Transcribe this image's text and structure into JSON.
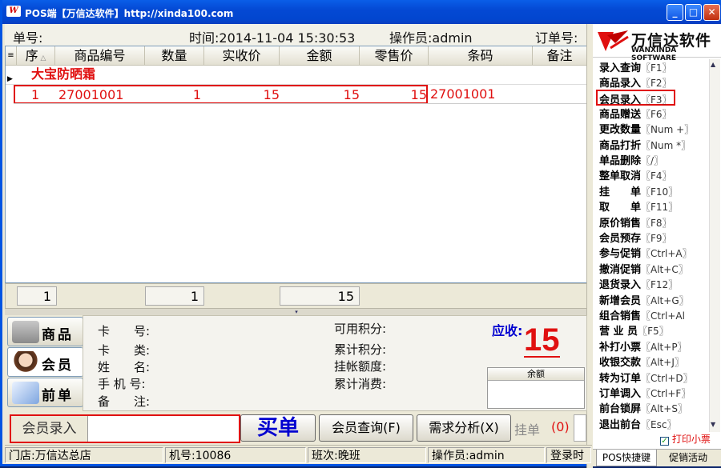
{
  "window": {
    "title": "POS端【万信达软件】http://xinda100.com",
    "app_icon": "logo-icon"
  },
  "topbar": {
    "order_no_label": "单号:",
    "time_label": "时间:2014-11-04 15:30:53",
    "operator_label": "操作员:admin",
    "pending_order_label": "订单号:"
  },
  "grid": {
    "columns": [
      "序",
      "商品编号",
      "数量",
      "实收价",
      "金额",
      "零售价",
      "条码",
      "备注"
    ],
    "group_title": "大宝防晒霜",
    "rows": [
      {
        "seq": "1",
        "code": "27001001",
        "qty": "1",
        "price": "15",
        "amount": "15",
        "retail": "15",
        "barcode": "27001001",
        "note": ""
      }
    ]
  },
  "totals": {
    "count": "1",
    "qty": "1",
    "amount": "15"
  },
  "tabs": [
    {
      "label": "商品",
      "icon": "product-icon"
    },
    {
      "label": "会员",
      "icon": "member-avatar-icon"
    },
    {
      "label": "前单",
      "icon": "previous-order-icon"
    }
  ],
  "member": {
    "card_no": "卡　　号:",
    "card_type": "卡　　类:",
    "name": "姓　　名:",
    "phone": "手 机 号:",
    "remark": "备　　注:",
    "points_available": "可用积分:",
    "points_total": "累计积分:",
    "credit_limit": "挂帐额度:",
    "total_spent": "累计消费:",
    "balance_header": "余额"
  },
  "due": {
    "label": "应收:",
    "amount": "15"
  },
  "bottom": {
    "mode_label": "会员录入",
    "input_value": "",
    "checkout": "买单",
    "member_query": "会员查询(F)",
    "demand_analysis": "需求分析(X)",
    "hold": "挂单",
    "hold_count": "(0)"
  },
  "status": {
    "store": "门店:万信达总店",
    "machine": "机号:10086",
    "shift": "班次:晚班",
    "operator": "操作员:admin",
    "login": "登录时"
  },
  "sidebar": {
    "brand_cn": "万信达软件",
    "brand_en": "WANXINDA SOFTWARE",
    "shortcuts": [
      {
        "label": "录入查询",
        "key": "〖F1〗"
      },
      {
        "label": "商品录入",
        "key": "〖F2〗"
      },
      {
        "label": "会员录入",
        "key": "〖F3〗"
      },
      {
        "label": "商品赠送",
        "key": "〖F6〗"
      },
      {
        "label": "更改数量",
        "key": "〖Num +〗"
      },
      {
        "label": "商品打折",
        "key": "〖Num *〗"
      },
      {
        "label": "单品删除",
        "key": "〖/〗"
      },
      {
        "label": "整单取消",
        "key": "〖F4〗"
      },
      {
        "label": "挂　　单",
        "key": "〖F10〗"
      },
      {
        "label": "取　　单",
        "key": "〖F11〗"
      },
      {
        "label": "原价销售",
        "key": "〖F8〗"
      },
      {
        "label": "会员预存",
        "key": "〖F9〗"
      },
      {
        "label": "参与促销",
        "key": "〖Ctrl+A〗"
      },
      {
        "label": "撤消促销",
        "key": "〖Alt+C〗"
      },
      {
        "label": "退货录入",
        "key": "〖F12〗"
      },
      {
        "label": "新增会员",
        "key": "〖Alt+G〗"
      },
      {
        "label": "组合销售",
        "key": "〖Ctrl+Al"
      },
      {
        "label": "营 业 员",
        "key": "〖F5〗"
      },
      {
        "label": "补打小票",
        "key": "〖Alt+P〗"
      },
      {
        "label": "收银交款",
        "key": "〖Alt+J〗"
      },
      {
        "label": "转为订单",
        "key": "〖Ctrl+D〗"
      },
      {
        "label": "订单调入",
        "key": "〖Ctrl+F〗"
      },
      {
        "label": "前台锁屏",
        "key": "〖Alt+S〗"
      },
      {
        "label": "退出前台",
        "key": "〖Esc〗"
      }
    ],
    "print_receipt": "打印小票",
    "tab_pos": "POS快捷键",
    "tab_promo": "促销活动"
  },
  "colors": {
    "title_blue": "#0449d4",
    "highlight_red": "#e01010",
    "due_blue": "#0000d0"
  }
}
